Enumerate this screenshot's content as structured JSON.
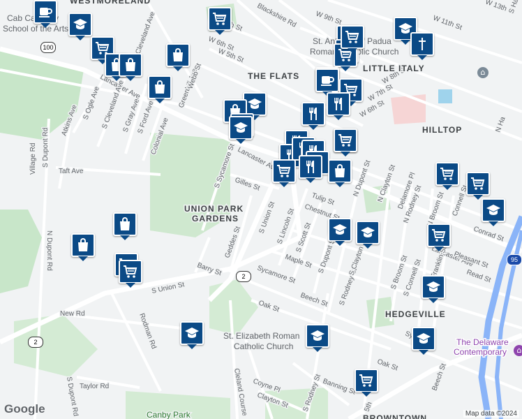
{
  "neighborhoods": [
    "WESTMORELAND",
    "THE FLATS",
    "LITTLE ITALY",
    "HILLTOP",
    "UNION PARK",
    "GARDENS",
    "HEDGEVILLE",
    "BROWNTOWN"
  ],
  "pois": [
    "Cab Calloway",
    "School of the Arts",
    "St. Anthony of Padua",
    "Roman Catholic Church",
    "St. Elizabeth Roman",
    "Catholic Church",
    "The Delaware",
    "Contemporary",
    "Canby Park"
  ],
  "streets": {
    "w9": "W 9th St",
    "w11": "W 11th St",
    "w13": "W 13th St",
    "w7": "W 7th St",
    "w6": "W 6th St",
    "w5": "W 5th St",
    "w8": "W 8th St",
    "w7b": "W 7th St",
    "w6b": "W 6th St",
    "blackshire": "Blackshire Rd",
    "lancaster_w": "Lancaster Ave",
    "lancaster_c": "Lancaster Ave",
    "lancaster_e": "Lancaster Ave",
    "greenhill": "Greenhill Ave",
    "webb": "Webb St",
    "ogle": "S Ogle Ave",
    "cleveland": "S Cleveland Ave",
    "cleveland_n": "Cleveland Ave",
    "gray": "S Gray Ave",
    "ford": "S Ford Ave",
    "colonial": "Colonial Ave",
    "atkins": "Atkins Ave",
    "taft": "Taft Ave",
    "village": "Village Rd",
    "s_dupont_w": "S Dupont Rd",
    "n_dupont_w": "N Dupont Rd",
    "s_dupont_sw": "S Dupont Rd",
    "sycamore_n": "S Sycamore St",
    "gilles": "Gilles St",
    "geddes": "Geddes St",
    "barry": "Barry St",
    "s_union": "S Union St",
    "s_union_main": "S Union St",
    "lincoln": "S Lincoln St",
    "scott": "S Scott St",
    "chestnut": "Chestnut St",
    "tulip": "Tulip St",
    "maple": "Maple St",
    "sycamore": "Sycamore St",
    "beech": "Beech St",
    "oak": "Oak St",
    "oak_e": "Oak St",
    "new_rd": "New Rd",
    "rodman": "Rodman Rd",
    "taylor": "Taylor Rd",
    "cleland": "Cleland Course",
    "coyne": "Coyne Pl",
    "clayton": "Clayton St",
    "banning": "Banning St",
    "s_rodney": "S Rodney St",
    "s_rodney_e": "S Rodney St",
    "s_dupont": "S Dupont St",
    "n_dupont": "N Dupont St",
    "s_clayton": "S Clayton St",
    "n_clayton": "N Clayton St",
    "delamore": "Delamore Pl",
    "n_rodney": "N Rodney St",
    "n_broom": "N Broom St",
    "s_broom": "S Broom St",
    "s_connell": "S Connell St",
    "connell": "Connell St",
    "s_franklin": "S Franklin St",
    "conrad": "Conrad St",
    "pleasant": "Pleasant St",
    "read": "Read St",
    "beech_e": "Beech St",
    "fifth": "5th",
    "syc": "Syc",
    "s_ha": "S Ha",
    "n_ha": "N Ha",
    "lancaster_e2": "Lancaster Ave"
  },
  "route_shields": [
    "100",
    "2",
    "2",
    "95"
  ],
  "markers": [
    {
      "icon": "cafe-icon"
    },
    {
      "icon": "school-icon"
    },
    {
      "icon": "grocery-cart-icon"
    },
    {
      "icon": "grocery-cart-icon"
    },
    {
      "icon": "grocery-cart-icon"
    },
    {
      "icon": "grocery-cart-icon"
    },
    {
      "icon": "school-icon"
    },
    {
      "icon": "place-of-worship-icon"
    },
    {
      "icon": "school-icon"
    },
    {
      "icon": "grocery-cart-icon"
    },
    {
      "icon": "shopping-bag-icon"
    },
    {
      "icon": "shopping-bag-icon"
    },
    {
      "icon": "shopping-bag-icon"
    },
    {
      "icon": "shopping-bag-icon"
    },
    {
      "icon": "grocery-cart-icon"
    },
    {
      "icon": "cafe-icon"
    },
    {
      "icon": "grocery-cart-icon"
    },
    {
      "icon": "shopping-bag-icon"
    },
    {
      "icon": "school-icon"
    },
    {
      "icon": "restaurant-icon"
    },
    {
      "icon": "restaurant-icon"
    },
    {
      "icon": "school-icon"
    },
    {
      "icon": "restaurant-icon"
    },
    {
      "icon": "shopping-bag-icon"
    },
    {
      "icon": "restaurant-icon"
    },
    {
      "icon": "restaurant-icon"
    },
    {
      "icon": "restaurant-icon"
    },
    {
      "icon": "restaurant-icon"
    },
    {
      "icon": "grocery-cart-icon"
    },
    {
      "icon": "restaurant-icon"
    },
    {
      "icon": "shopping-bag-icon"
    },
    {
      "icon": "grocery-cart-icon"
    },
    {
      "icon": "grocery-cart-icon"
    },
    {
      "icon": "school-icon"
    },
    {
      "icon": "school-icon"
    },
    {
      "icon": "school-icon"
    },
    {
      "icon": "grocery-cart-icon"
    },
    {
      "icon": "shopping-bag-icon"
    },
    {
      "icon": "shopping-bag-icon"
    },
    {
      "icon": "grocery-cart-icon"
    },
    {
      "icon": "grocery-cart-icon"
    },
    {
      "icon": "school-icon"
    },
    {
      "icon": "school-icon"
    },
    {
      "icon": "school-icon"
    },
    {
      "icon": "grocery-cart-icon"
    },
    {
      "icon": "school-icon"
    },
    {
      "icon": "grocery-cart-icon"
    },
    {
      "icon": "grocery-cart-icon"
    }
  ],
  "google_logo": "Google",
  "attribution": "Map data ©2024",
  "colors": {
    "marker": "#0b4a86",
    "park": "#c8e6c9",
    "highway": "#8ab4f8",
    "road": "#ffffff"
  }
}
